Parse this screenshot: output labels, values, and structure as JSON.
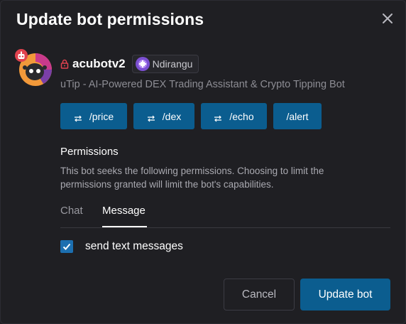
{
  "dialog": {
    "title": "Update bot permissions",
    "close_icon": "close-icon"
  },
  "bot": {
    "name": "acubotv2",
    "owner": "Ndirangu",
    "description": "uTip - AI-Powered DEX Trading Assistant & Crypto Tipping Bot",
    "locked_icon": "lock-icon",
    "commands": [
      {
        "label": "/price",
        "icon": "swap-arrows-icon"
      },
      {
        "label": "/dex",
        "icon": "swap-arrows-icon"
      },
      {
        "label": "/echo",
        "icon": "swap-arrows-icon"
      },
      {
        "label": "/alert"
      }
    ]
  },
  "permissions": {
    "heading": "Permissions",
    "description": "This bot seeks the following permissions. Choosing to limit the permissions granted will limit the bot's capabilities.",
    "tabs": [
      {
        "label": "Chat",
        "active": false
      },
      {
        "label": "Message",
        "active": true
      }
    ],
    "items": [
      {
        "label": "send text messages",
        "checked": true
      }
    ]
  },
  "actions": {
    "cancel_label": "Cancel",
    "update_label": "Update bot"
  },
  "colors": {
    "background": "#1f1f23",
    "accent": "#0b5d8f",
    "checkbox": "#1c6fb0",
    "lock": "#e0424e"
  }
}
